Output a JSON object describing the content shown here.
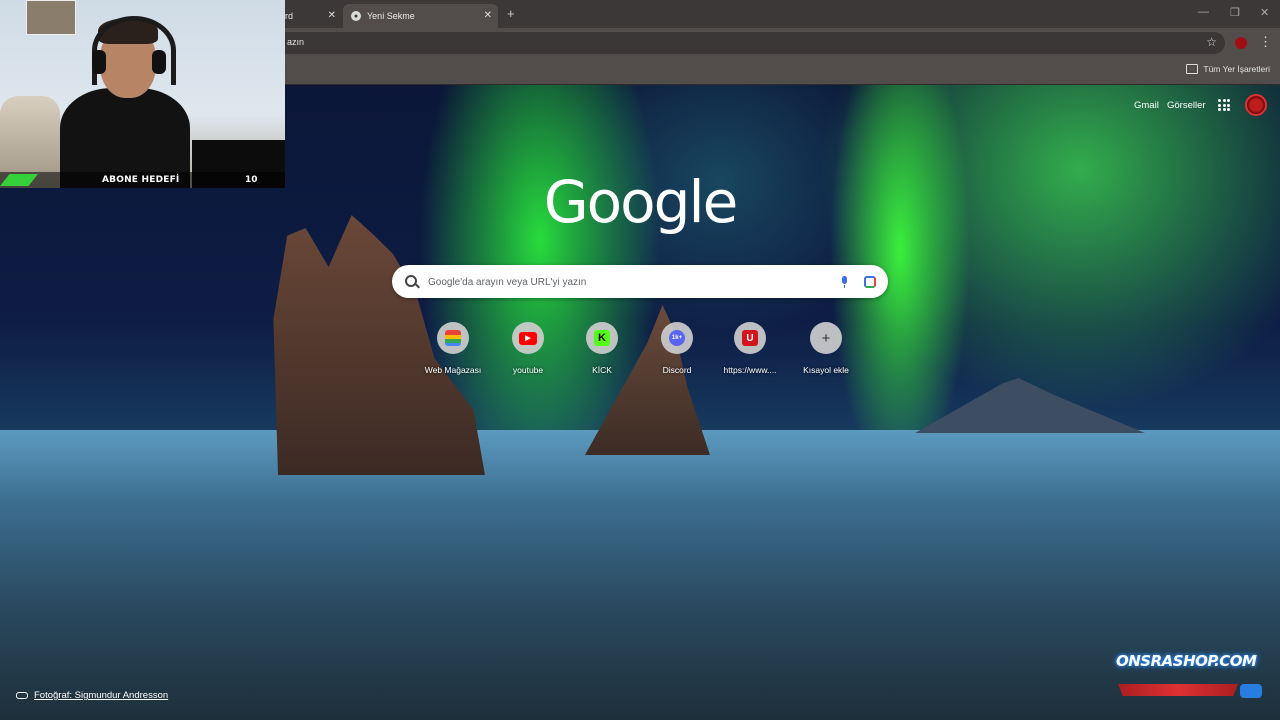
{
  "webcam": {
    "goal_label": "ABONE HEDEFİ",
    "goal_value": "10"
  },
  "tabs": [
    {
      "label": "rd",
      "active": false
    },
    {
      "label": "Yeni Sekme",
      "active": true
    }
  ],
  "omnibox": {
    "text": "azın"
  },
  "bookmarks": {
    "all_label": "Tüm Yer İşaretleri"
  },
  "header_links": {
    "gmail": "Gmail",
    "images": "Görseller"
  },
  "logo": "Google",
  "search": {
    "placeholder": "Google'da arayın veya URL'yi yazın"
  },
  "shortcuts": [
    {
      "label": "Web Mağazası",
      "glyph": "",
      "color": "#e8e8e8",
      "icon": "chrome-web-store-icon"
    },
    {
      "label": "youtube",
      "glyph": "▶",
      "color": "#ff0000",
      "icon": "youtube-icon"
    },
    {
      "label": "KİCK",
      "glyph": "K",
      "color": "#53fc18",
      "icon": "kick-icon"
    },
    {
      "label": "Discord",
      "glyph": "1k+",
      "color": "#5865f2",
      "icon": "discord-icon"
    },
    {
      "label": "https://www....",
      "glyph": "U",
      "color": "#d4141c",
      "icon": "u-site-icon"
    },
    {
      "label": "Kısayol ekle",
      "glyph": "+",
      "color": "transparent",
      "icon": "add-icon"
    }
  ],
  "photo_credit": "Fotoğraf: Sigmundur Andresson",
  "watermark": {
    "part1": "ONSRA",
    "part2": "SHOP.COM"
  },
  "colors": {
    "tabbar": "#3c3838",
    "toolbar": "#524d4b",
    "profile": "#a10f12"
  }
}
